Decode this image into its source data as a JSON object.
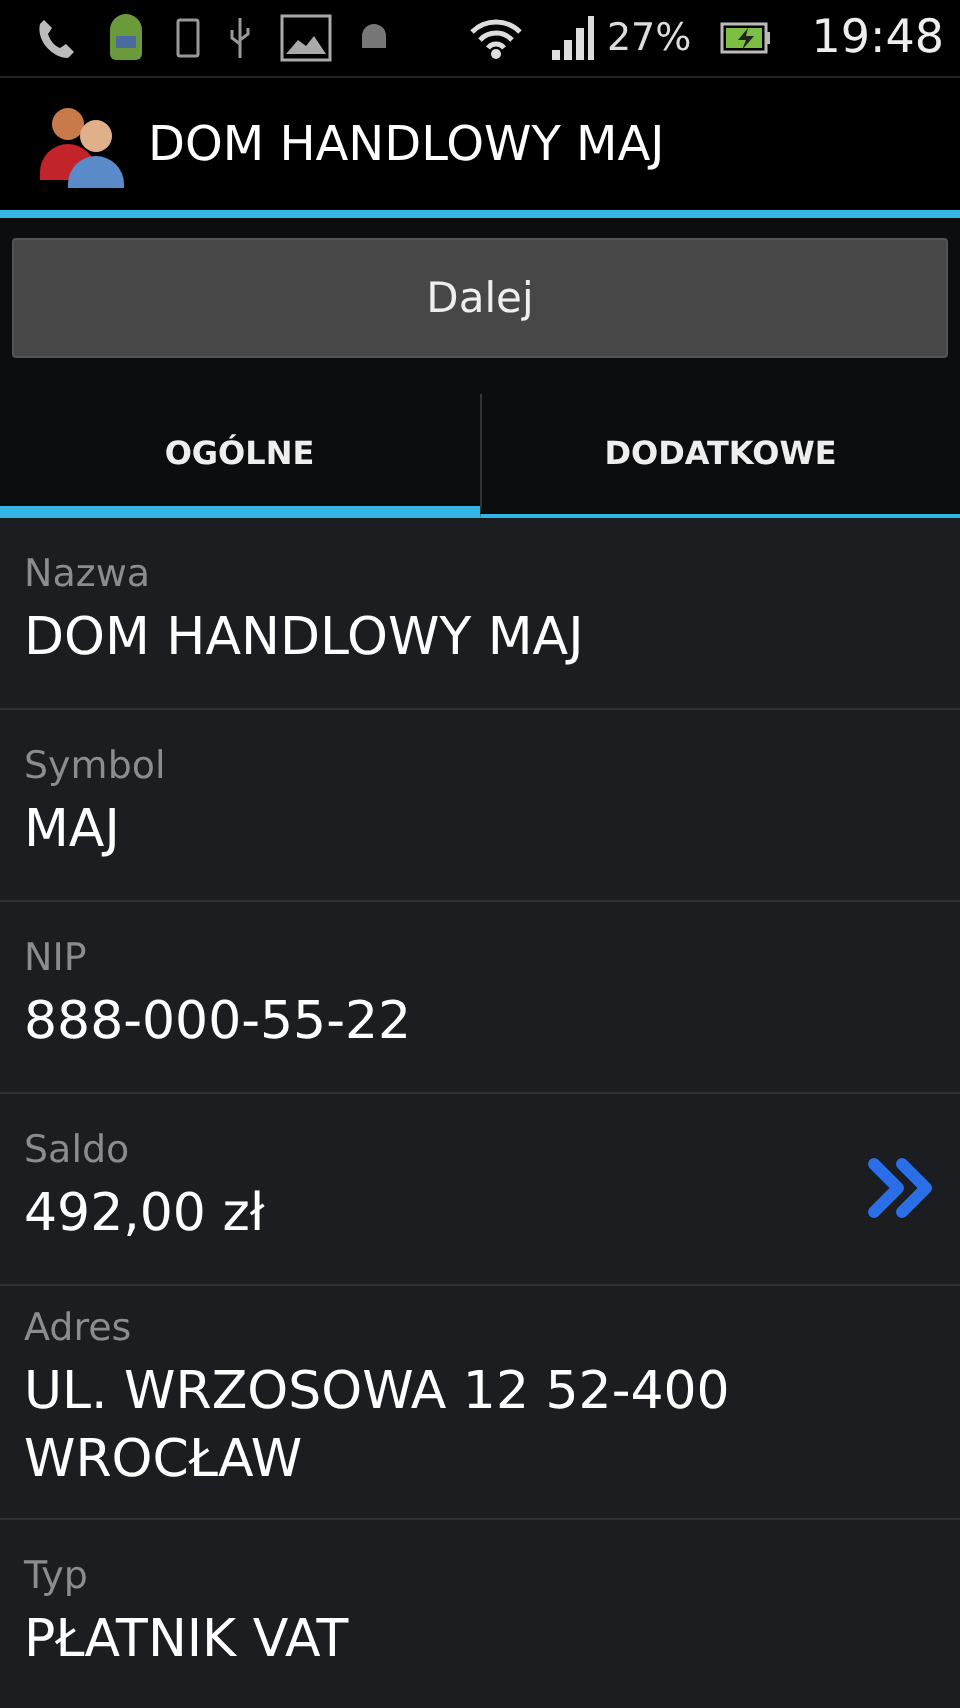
{
  "status_bar": {
    "battery": "27%",
    "time": "19:48"
  },
  "action_bar": {
    "title": "DOM HANDLOWY MAJ"
  },
  "next_button": "Dalej",
  "tabs": [
    {
      "label": "OGÓLNE",
      "selected": true
    },
    {
      "label": "DODATKOWE",
      "selected": false
    }
  ],
  "fields": [
    {
      "kind": "plain",
      "label": "Nazwa",
      "value": "DOM HANDLOWY MAJ"
    },
    {
      "kind": "plain",
      "label": "Symbol",
      "value": "MAJ"
    },
    {
      "kind": "plain",
      "label": "NIP",
      "value": "888-000-55-22"
    },
    {
      "kind": "link",
      "label": "Saldo",
      "value": "492,00 zł"
    },
    {
      "kind": "plain",
      "label": "Adres",
      "value": "UL. WRZOSOWA 12 52-400 WROCŁAW"
    },
    {
      "kind": "plain",
      "label": "Typ",
      "value": "PŁATNIK VAT"
    }
  ]
}
